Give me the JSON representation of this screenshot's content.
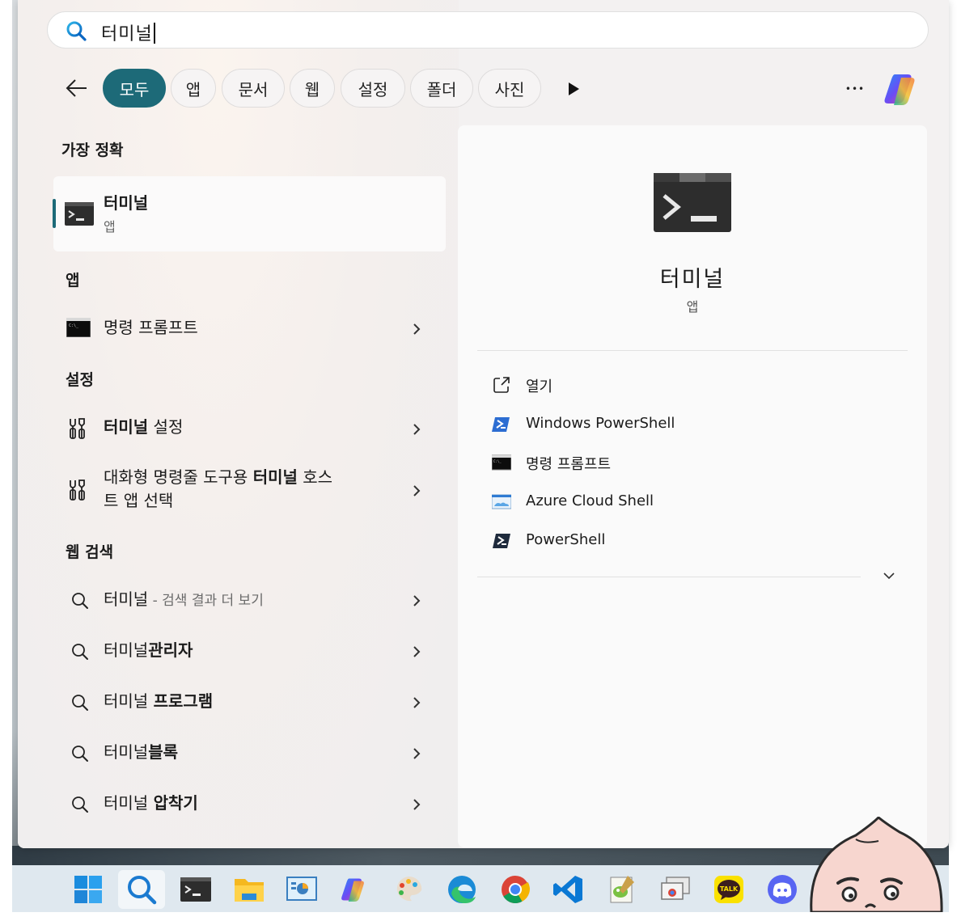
{
  "search": {
    "query": "터미널"
  },
  "filters": {
    "chips": [
      {
        "label": "모두",
        "active": true
      },
      {
        "label": "앱"
      },
      {
        "label": "문서"
      },
      {
        "label": "웹"
      },
      {
        "label": "설정"
      },
      {
        "label": "폴더"
      },
      {
        "label": "사진"
      }
    ],
    "more_symbol": "•••"
  },
  "best_match": {
    "heading": "가장 정확",
    "title": "터미널",
    "type": "앱",
    "icon": "terminal-icon"
  },
  "apps": {
    "heading": "앱",
    "items": [
      {
        "label": "명령 프롬프트",
        "icon": "cmd-icon"
      }
    ]
  },
  "settings": {
    "heading": "설정",
    "items": [
      {
        "bold": "터미널",
        "rest": " 설정",
        "icon": "settings-tools-icon"
      },
      {
        "pre": "대화형 명령줄 도구용 ",
        "bold": "터미널",
        "rest": " 호스",
        "line2": "트 앱 선택",
        "icon": "settings-tools-icon"
      }
    ]
  },
  "web": {
    "heading": "웹 검색",
    "items": [
      {
        "plain": "터미널",
        "bold": "",
        "hint": " - 검색 결과 더 보기"
      },
      {
        "plain": "터미널",
        "bold": "관리자"
      },
      {
        "plain": "터미널 ",
        "bold": "프로그램"
      },
      {
        "plain": "터미널",
        "bold": "블록"
      },
      {
        "plain": "터미널 ",
        "bold": "압착기"
      }
    ]
  },
  "detail": {
    "title": "터미널",
    "type": "앱",
    "actions": [
      {
        "label": "열기",
        "icon": "open-external-icon"
      },
      {
        "label": "Windows PowerShell",
        "icon": "powershell-icon"
      },
      {
        "label": "명령 프롬프트",
        "icon": "cmd-icon"
      },
      {
        "label": "Azure Cloud Shell",
        "icon": "azure-cloud-shell-icon"
      },
      {
        "label": "PowerShell",
        "icon": "powershell-core-icon"
      }
    ]
  },
  "taskbar": {
    "items": [
      "start-icon",
      "search-icon",
      "terminal-icon",
      "file-explorer-icon",
      "control-panel-icon",
      "copilot-icon",
      "paint-icon",
      "edge-icon",
      "chrome-icon",
      "vscode-icon",
      "notepad-plus-icon",
      "remote-desktop-icon",
      "kakaotalk-icon",
      "discord-icon"
    ],
    "kakao_label": "TALK"
  },
  "colors": {
    "accent": "#1d6a78",
    "panel": "#f3f1f1",
    "taskbar": "#dfe8ef"
  }
}
